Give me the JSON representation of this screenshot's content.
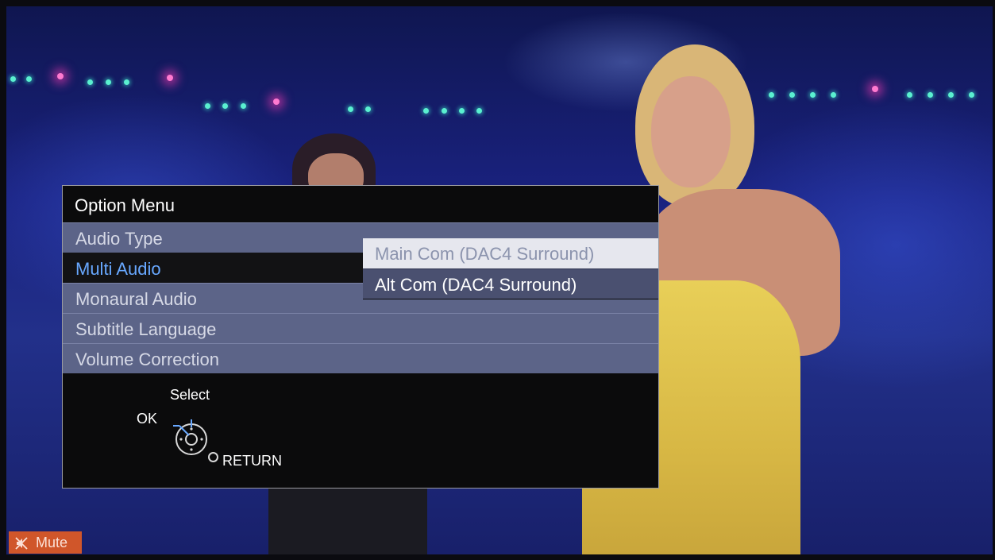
{
  "option_menu": {
    "title": "Option Menu",
    "items": [
      {
        "label": "Audio Type"
      },
      {
        "label": "Multi Audio"
      },
      {
        "label": "Monaural Audio"
      },
      {
        "label": "Subtitle Language"
      },
      {
        "label": "Volume Correction"
      }
    ],
    "selected_item": "Multi Audio",
    "footer": {
      "select_label": "Select",
      "ok_label": "OK",
      "return_label": "RETURN"
    }
  },
  "submenu": {
    "items": [
      {
        "label": "Main Com (DAC4 Surround)"
      },
      {
        "label": "Alt Com (DAC4 Surround)"
      }
    ]
  },
  "status": {
    "mute_label": "Mute",
    "mute_icon": "speaker-muted-icon"
  },
  "colors": {
    "selected_text": "#68a8ff",
    "menu_item_bg": "#5c6488",
    "mute_bg": "#d0562a"
  }
}
